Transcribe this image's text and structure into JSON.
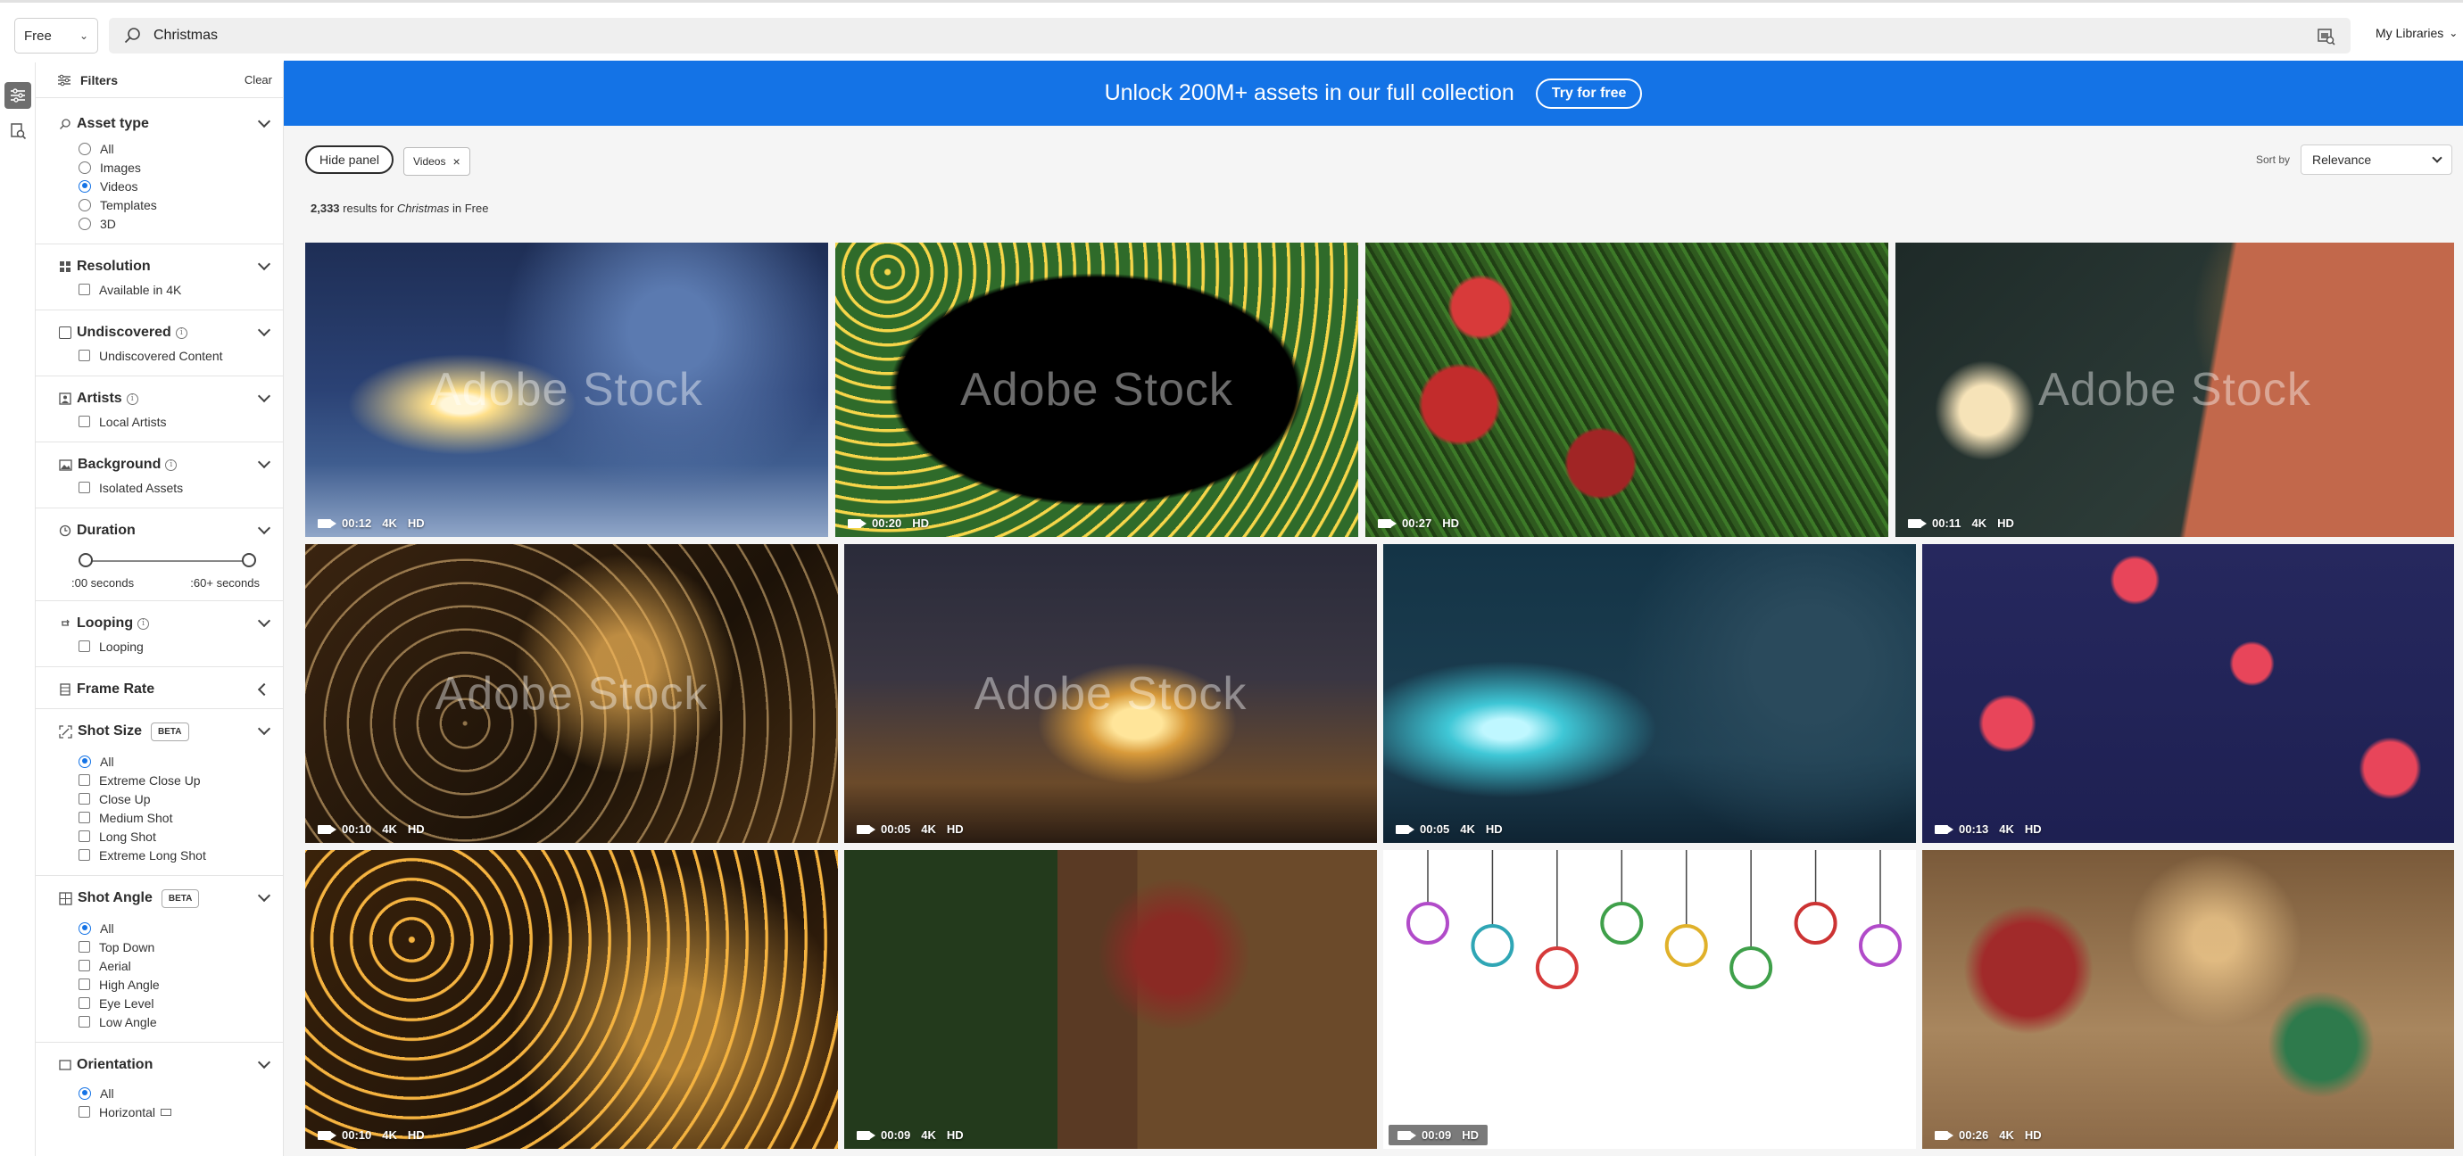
{
  "search": {
    "scope": "Free",
    "query": "Christmas",
    "my_libraries": "My Libraries"
  },
  "filters": {
    "title": "Filters",
    "clear": "Clear",
    "asset_type": {
      "title": "Asset type",
      "options": [
        "All",
        "Images",
        "Videos",
        "Templates",
        "3D"
      ],
      "selected": "Videos"
    },
    "resolution": {
      "title": "Resolution",
      "option": "Available in 4K"
    },
    "undiscovered": {
      "title": "Undiscovered",
      "option": "Undiscovered Content"
    },
    "artists": {
      "title": "Artists",
      "option": "Local Artists"
    },
    "background": {
      "title": "Background",
      "option": "Isolated Assets"
    },
    "duration": {
      "title": "Duration",
      "min_label": ":00 seconds",
      "max_label": ":60+ seconds"
    },
    "looping": {
      "title": "Looping",
      "option": "Looping"
    },
    "frame_rate": {
      "title": "Frame Rate"
    },
    "shot_size": {
      "title": "Shot Size",
      "badge": "BETA",
      "options": [
        "All",
        "Extreme Close Up",
        "Close Up",
        "Medium Shot",
        "Long Shot",
        "Extreme Long Shot"
      ],
      "selected": "All"
    },
    "shot_angle": {
      "title": "Shot Angle",
      "badge": "BETA",
      "options": [
        "All",
        "Top Down",
        "Aerial",
        "High Angle",
        "Eye Level",
        "Low Angle"
      ],
      "selected": "All"
    },
    "orientation": {
      "title": "Orientation",
      "options": [
        "All",
        "Horizontal"
      ],
      "selected": "All"
    }
  },
  "banner": {
    "text": "Unlock 200M+ assets in our full collection",
    "button": "Try for free"
  },
  "toolbar": {
    "hide_panel": "Hide panel",
    "chip": "Videos",
    "sort_label": "Sort by",
    "sort_value": "Relevance"
  },
  "results": {
    "count": "2,333",
    "text_mid": " results for ",
    "query": "Christmas",
    "text_end": " in Free"
  },
  "watermark": "Adobe Stock",
  "videos": [
    {
      "duration": "00:12",
      "badges": [
        "4K",
        "HD"
      ],
      "watermark": true,
      "theme": "snowy-tree-night"
    },
    {
      "duration": "00:20",
      "badges": [
        "HD"
      ],
      "watermark": true,
      "theme": "garland-frame"
    },
    {
      "duration": "00:27",
      "badges": [
        "HD"
      ],
      "watermark": false,
      "theme": "ornaments-closeup"
    },
    {
      "duration": "00:11",
      "badges": [
        "4K",
        "HD"
      ],
      "watermark": true,
      "theme": "gift-boxes-lamp"
    },
    {
      "duration": "00:10",
      "badges": [
        "4K",
        "HD"
      ],
      "watermark": true,
      "theme": "golden-bokeh"
    },
    {
      "duration": "00:05",
      "badges": [
        "4K",
        "HD"
      ],
      "watermark": true,
      "theme": "town-square-tree"
    },
    {
      "duration": "00:05",
      "badges": [
        "4K",
        "HD"
      ],
      "watermark": false,
      "theme": "teal-bokeh-tree"
    },
    {
      "duration": "00:13",
      "badges": [
        "4K",
        "HD"
      ],
      "watermark": false,
      "theme": "falling-gifts-navy"
    },
    {
      "duration": "00:10",
      "badges": [
        "4K",
        "HD"
      ],
      "watermark": false,
      "theme": "golden-snowflakes"
    },
    {
      "duration": "00:09",
      "badges": [
        "4K",
        "HD"
      ],
      "watermark": false,
      "theme": "family-decorating-tree"
    },
    {
      "duration": "00:09",
      "badges": [
        "HD"
      ],
      "watermark": false,
      "theme": "hanging-ornament-icons"
    },
    {
      "duration": "00:26",
      "badges": [
        "4K",
        "HD"
      ],
      "watermark": false,
      "theme": "presents-table"
    }
  ],
  "colors": {
    "accent": "#1473e6",
    "radio_selected": "#1473e6"
  }
}
